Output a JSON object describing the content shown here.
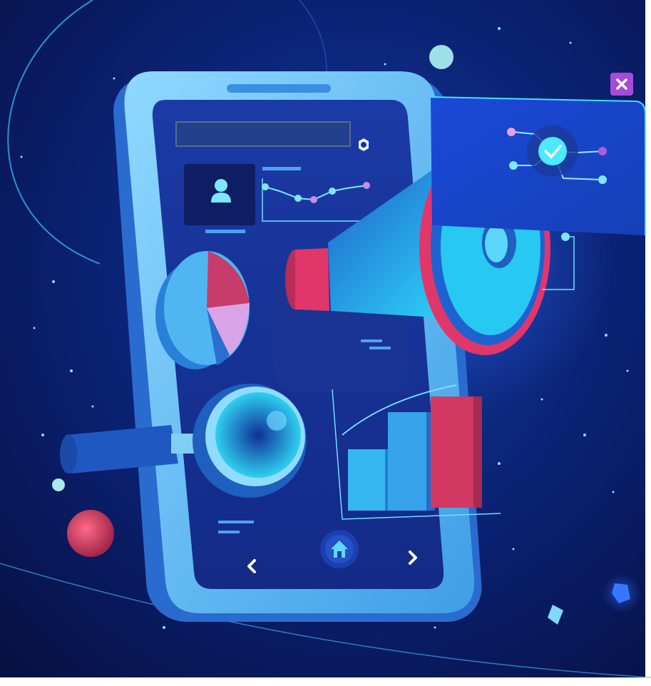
{
  "colors": {
    "background": "#0a1650",
    "phone_frame": "#5fc1f2",
    "screen": "#16309a",
    "accent_cyan": "#27e0ff",
    "accent_pink": "#e0366a",
    "accent_purple": "#a54bd8"
  },
  "icons": {
    "user": "user-icon",
    "settings": "gear-icon",
    "close": "close-icon",
    "back": "chevron-left-icon",
    "home": "home-icon",
    "forward": "chevron-right-icon",
    "search": "magnifier-icon",
    "announce": "megaphone-icon",
    "check": "check-icon"
  },
  "charts": {
    "bar_values": [
      2,
      3,
      4
    ],
    "pie_segments": 4
  }
}
